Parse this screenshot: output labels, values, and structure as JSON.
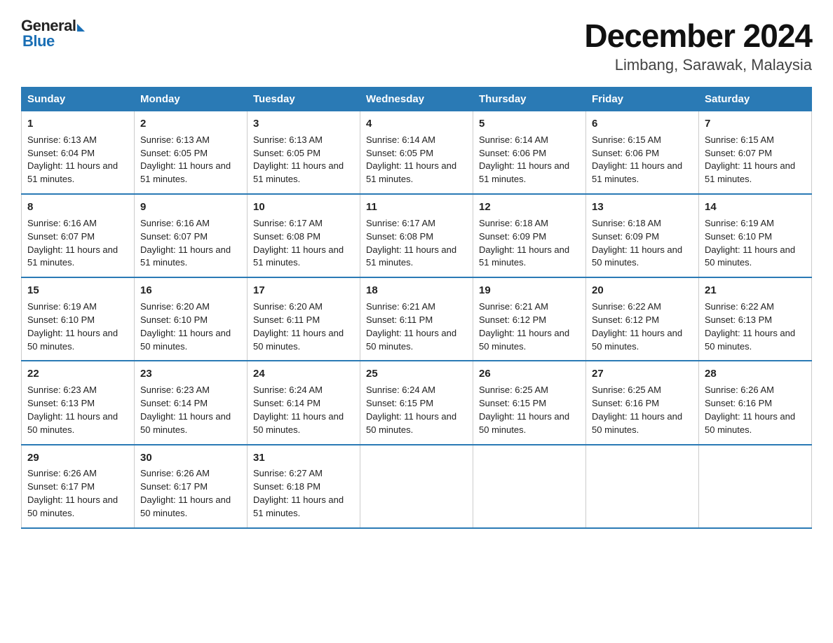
{
  "header": {
    "logo": {
      "general": "General",
      "blue": "Blue"
    },
    "title": "December 2024",
    "subtitle": "Limbang, Sarawak, Malaysia"
  },
  "days_of_week": [
    "Sunday",
    "Monday",
    "Tuesday",
    "Wednesday",
    "Thursday",
    "Friday",
    "Saturday"
  ],
  "weeks": [
    [
      {
        "day": "1",
        "sunrise": "6:13 AM",
        "sunset": "6:04 PM",
        "daylight": "11 hours and 51 minutes."
      },
      {
        "day": "2",
        "sunrise": "6:13 AM",
        "sunset": "6:05 PM",
        "daylight": "11 hours and 51 minutes."
      },
      {
        "day": "3",
        "sunrise": "6:13 AM",
        "sunset": "6:05 PM",
        "daylight": "11 hours and 51 minutes."
      },
      {
        "day": "4",
        "sunrise": "6:14 AM",
        "sunset": "6:05 PM",
        "daylight": "11 hours and 51 minutes."
      },
      {
        "day": "5",
        "sunrise": "6:14 AM",
        "sunset": "6:06 PM",
        "daylight": "11 hours and 51 minutes."
      },
      {
        "day": "6",
        "sunrise": "6:15 AM",
        "sunset": "6:06 PM",
        "daylight": "11 hours and 51 minutes."
      },
      {
        "day": "7",
        "sunrise": "6:15 AM",
        "sunset": "6:07 PM",
        "daylight": "11 hours and 51 minutes."
      }
    ],
    [
      {
        "day": "8",
        "sunrise": "6:16 AM",
        "sunset": "6:07 PM",
        "daylight": "11 hours and 51 minutes."
      },
      {
        "day": "9",
        "sunrise": "6:16 AM",
        "sunset": "6:07 PM",
        "daylight": "11 hours and 51 minutes."
      },
      {
        "day": "10",
        "sunrise": "6:17 AM",
        "sunset": "6:08 PM",
        "daylight": "11 hours and 51 minutes."
      },
      {
        "day": "11",
        "sunrise": "6:17 AM",
        "sunset": "6:08 PM",
        "daylight": "11 hours and 51 minutes."
      },
      {
        "day": "12",
        "sunrise": "6:18 AM",
        "sunset": "6:09 PM",
        "daylight": "11 hours and 51 minutes."
      },
      {
        "day": "13",
        "sunrise": "6:18 AM",
        "sunset": "6:09 PM",
        "daylight": "11 hours and 50 minutes."
      },
      {
        "day": "14",
        "sunrise": "6:19 AM",
        "sunset": "6:10 PM",
        "daylight": "11 hours and 50 minutes."
      }
    ],
    [
      {
        "day": "15",
        "sunrise": "6:19 AM",
        "sunset": "6:10 PM",
        "daylight": "11 hours and 50 minutes."
      },
      {
        "day": "16",
        "sunrise": "6:20 AM",
        "sunset": "6:10 PM",
        "daylight": "11 hours and 50 minutes."
      },
      {
        "day": "17",
        "sunrise": "6:20 AM",
        "sunset": "6:11 PM",
        "daylight": "11 hours and 50 minutes."
      },
      {
        "day": "18",
        "sunrise": "6:21 AM",
        "sunset": "6:11 PM",
        "daylight": "11 hours and 50 minutes."
      },
      {
        "day": "19",
        "sunrise": "6:21 AM",
        "sunset": "6:12 PM",
        "daylight": "11 hours and 50 minutes."
      },
      {
        "day": "20",
        "sunrise": "6:22 AM",
        "sunset": "6:12 PM",
        "daylight": "11 hours and 50 minutes."
      },
      {
        "day": "21",
        "sunrise": "6:22 AM",
        "sunset": "6:13 PM",
        "daylight": "11 hours and 50 minutes."
      }
    ],
    [
      {
        "day": "22",
        "sunrise": "6:23 AM",
        "sunset": "6:13 PM",
        "daylight": "11 hours and 50 minutes."
      },
      {
        "day": "23",
        "sunrise": "6:23 AM",
        "sunset": "6:14 PM",
        "daylight": "11 hours and 50 minutes."
      },
      {
        "day": "24",
        "sunrise": "6:24 AM",
        "sunset": "6:14 PM",
        "daylight": "11 hours and 50 minutes."
      },
      {
        "day": "25",
        "sunrise": "6:24 AM",
        "sunset": "6:15 PM",
        "daylight": "11 hours and 50 minutes."
      },
      {
        "day": "26",
        "sunrise": "6:25 AM",
        "sunset": "6:15 PM",
        "daylight": "11 hours and 50 minutes."
      },
      {
        "day": "27",
        "sunrise": "6:25 AM",
        "sunset": "6:16 PM",
        "daylight": "11 hours and 50 minutes."
      },
      {
        "day": "28",
        "sunrise": "6:26 AM",
        "sunset": "6:16 PM",
        "daylight": "11 hours and 50 minutes."
      }
    ],
    [
      {
        "day": "29",
        "sunrise": "6:26 AM",
        "sunset": "6:17 PM",
        "daylight": "11 hours and 50 minutes."
      },
      {
        "day": "30",
        "sunrise": "6:26 AM",
        "sunset": "6:17 PM",
        "daylight": "11 hours and 50 minutes."
      },
      {
        "day": "31",
        "sunrise": "6:27 AM",
        "sunset": "6:18 PM",
        "daylight": "11 hours and 51 minutes."
      },
      null,
      null,
      null,
      null
    ]
  ]
}
